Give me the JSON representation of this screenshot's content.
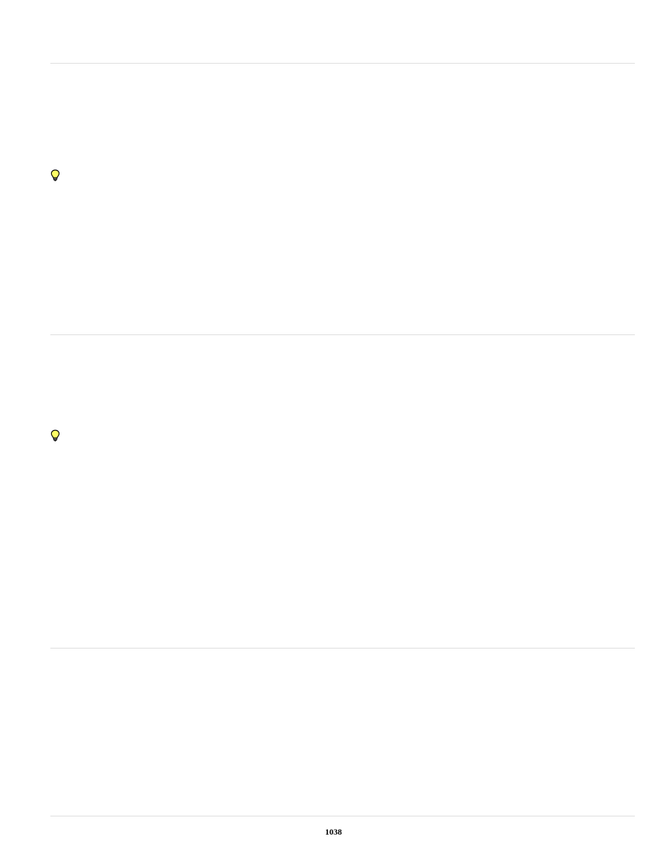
{
  "page_number": "1038"
}
